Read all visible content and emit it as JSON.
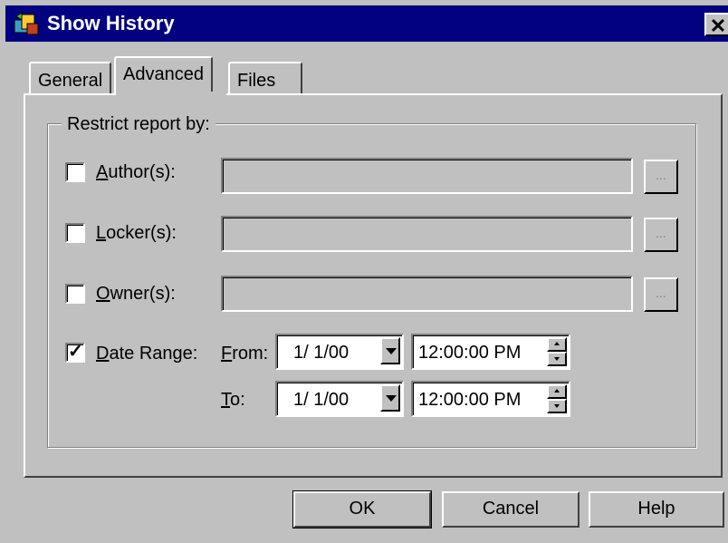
{
  "window": {
    "title": "Show History",
    "close_glyph": "✕"
  },
  "tabs": [
    {
      "label": "General",
      "active": false
    },
    {
      "label": "Advanced",
      "active": true
    },
    {
      "label": "Files",
      "active": false
    }
  ],
  "group": {
    "label": "Restrict report by:"
  },
  "restrictions": [
    {
      "key": "author",
      "checked": false,
      "label_first": "A",
      "label_rest": "uthor(s):",
      "value": "",
      "browse": "..."
    },
    {
      "key": "locker",
      "checked": false,
      "label_first": "L",
      "label_rest": "ocker(s):",
      "value": "",
      "browse": "..."
    },
    {
      "key": "owner",
      "checked": false,
      "label_first": "O",
      "label_rest": "wner(s):",
      "value": "",
      "browse": "..."
    }
  ],
  "date_range": {
    "checked": true,
    "check_glyph": "✓",
    "label_first": "D",
    "label_rest": "ate Range:",
    "from": {
      "label_first": "F",
      "label_rest": "rom:",
      "date": "1/ 1/00",
      "time": "12:00:00 PM"
    },
    "to": {
      "label_first": "T",
      "label_rest": "o:",
      "date": "1/ 1/00",
      "time": "12:00:00 PM"
    }
  },
  "buttons": {
    "ok": "OK",
    "cancel": "Cancel",
    "help": "Help"
  },
  "colors": {
    "face": "#c0c0c0",
    "titlebar": "#000080"
  },
  "icons": {
    "title": "history-app-icon",
    "dropdown": "chevron-down-icon",
    "spin_up": "spin-up-icon",
    "spin_down": "spin-down-icon"
  }
}
